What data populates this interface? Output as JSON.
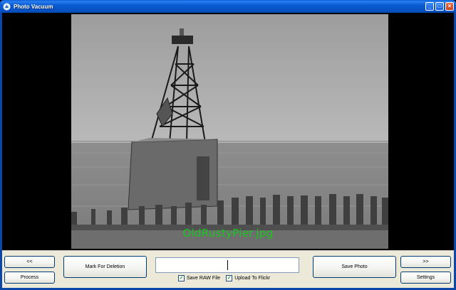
{
  "window": {
    "title": "Photo Vacuum",
    "controls": {
      "minimize": "_",
      "maximize": "□",
      "close": "×"
    }
  },
  "viewer": {
    "filename": "OldRustyPier.jpg",
    "filename_color": "#17c71d"
  },
  "buttons": {
    "prev": "<<",
    "next": ">>",
    "process": "Process",
    "mark_for_deletion": "Mark For Deletion",
    "save_photo": "Save Photo",
    "settings": "Settings"
  },
  "text_input": {
    "value": "",
    "placeholder": ""
  },
  "options": {
    "save_raw": {
      "label": "Save RAW File",
      "checked": true,
      "mark": "✓"
    },
    "upload_flickr": {
      "label": "Upload To Flickr",
      "checked": true,
      "mark": "✓"
    }
  },
  "icons": {
    "app": "vacuum-icon",
    "minimize": "minimize-icon",
    "maximize": "maximize-icon",
    "close": "close-icon"
  },
  "colors": {
    "titlebar": "#0a5bd0",
    "panel": "#ece9d8",
    "button_border": "#003c74"
  }
}
